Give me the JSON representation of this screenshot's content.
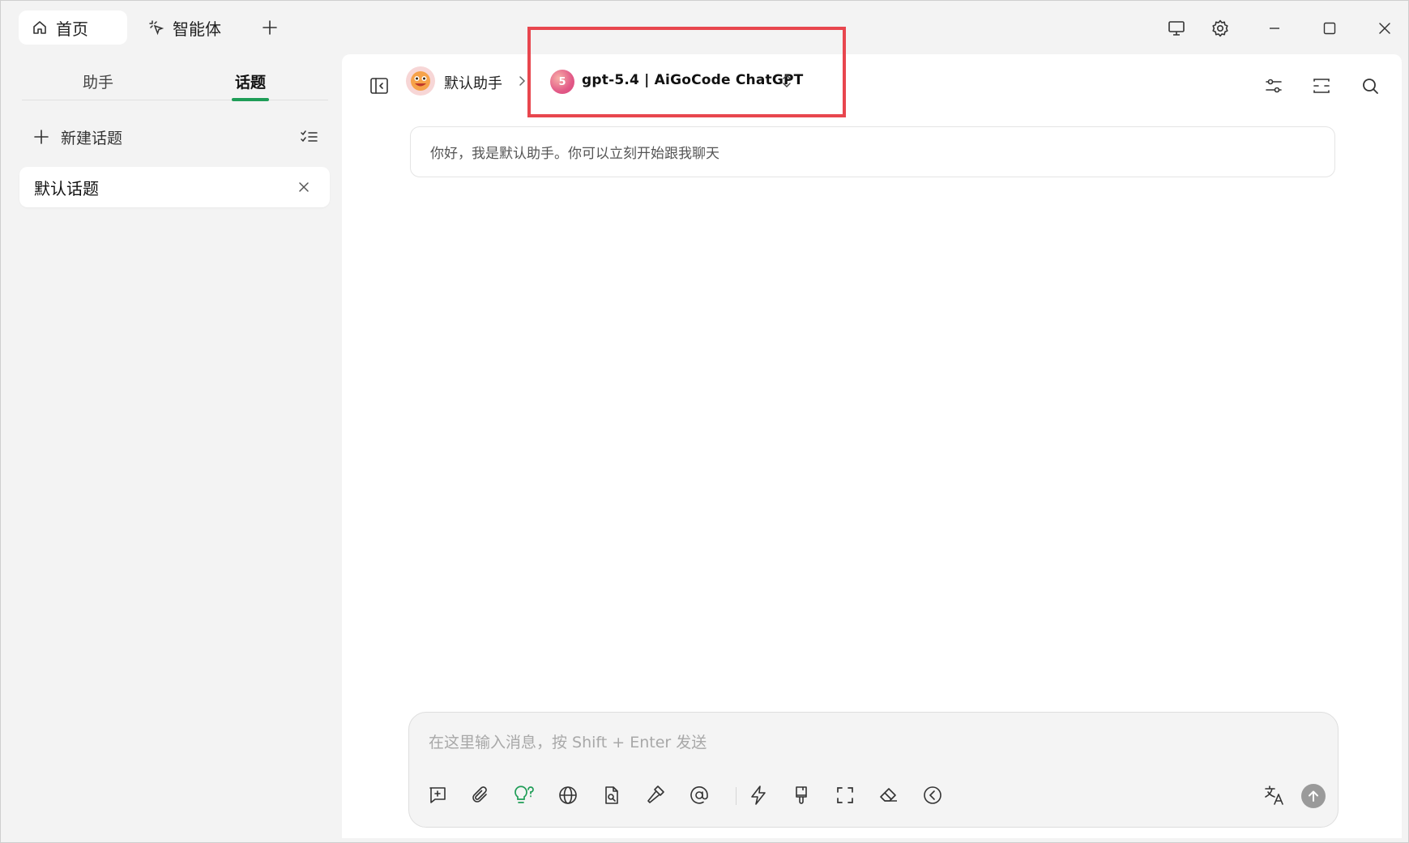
{
  "tabs": {
    "home_label": "首页",
    "agents_label": "智能体"
  },
  "sidebar": {
    "segments": [
      "助手",
      "话题"
    ],
    "active_segment": "话题",
    "new_topic_label": "新建话题",
    "topics": [
      {
        "label": "默认话题"
      }
    ]
  },
  "header": {
    "assistant_name": "默认助手",
    "model_logo_text": "5",
    "model_name": "gpt-5.4 | AiGoCode ChatGPT"
  },
  "chat": {
    "greeting": "你好，我是默认助手。你可以立刻开始跟我聊天"
  },
  "composer": {
    "placeholder": "在这里输入消息，按 Shift + Enter 发送",
    "value": ""
  },
  "colors": {
    "accent": "#1f9d57",
    "highlight_box": "#e8464e",
    "send_button": "#9a9a9a"
  },
  "icons": [
    "home-icon",
    "agent-cursor-icon",
    "plus-icon",
    "monitor-icon",
    "gear-icon",
    "minimize-icon",
    "maximize-icon",
    "close-icon",
    "sidebar-toggle-icon",
    "chevron-right-icon",
    "updown-chevron-icon",
    "sliders-icon",
    "expand-icon",
    "search-icon",
    "new-chat-icon",
    "paperclip-icon",
    "lightbulb-icon",
    "globe-icon",
    "file-search-icon",
    "hammer-icon",
    "at-icon",
    "lightning-icon",
    "brush-icon",
    "fullscreen-icon",
    "eraser-icon",
    "back-circle-icon",
    "translate-icon",
    "send-arrow-icon"
  ]
}
